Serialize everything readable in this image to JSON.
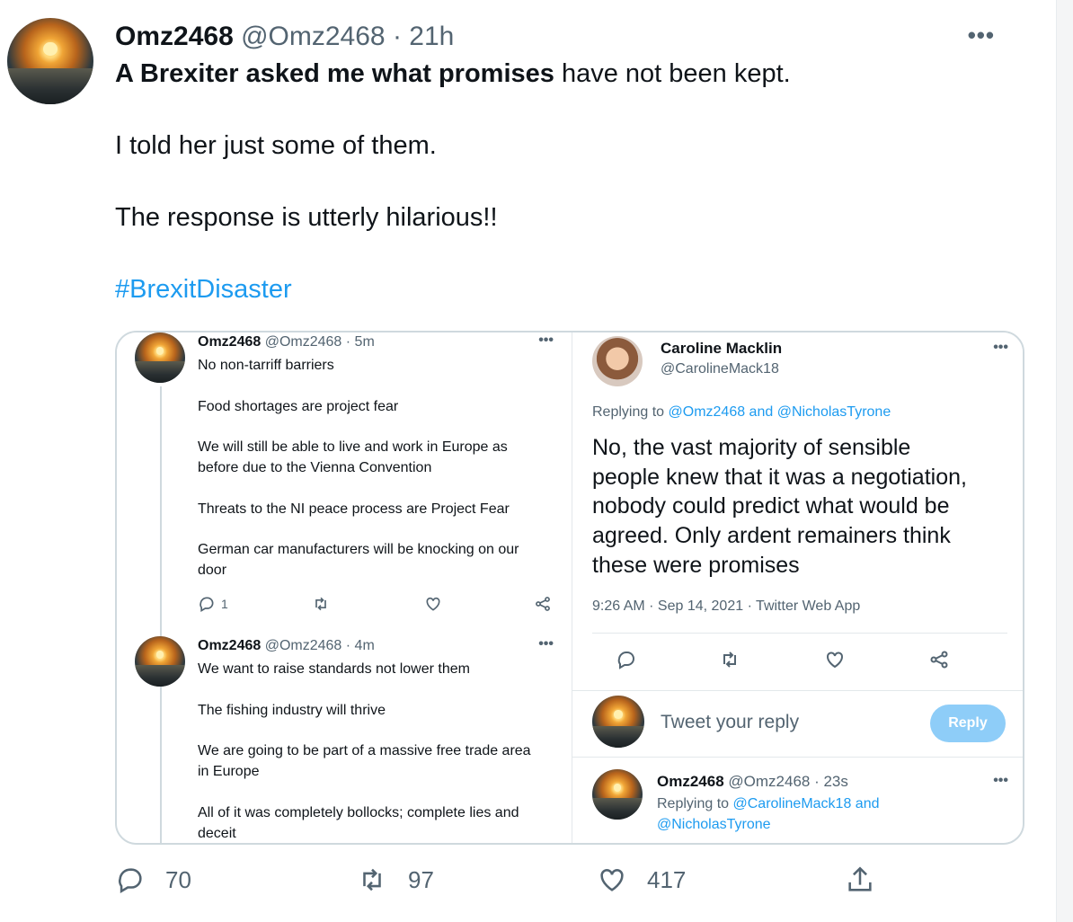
{
  "tweet": {
    "author_name": "Omz2468",
    "author_handle": "@Omz2468",
    "time": "· 21h",
    "line1_bold": "A Brexiter asked me what promises",
    "line1_rest": " have not been kept.",
    "line2": "I told her just some of them.",
    "line3": "The response is utterly hilarious!!",
    "hashtag": "#BrexitDisaster",
    "more": "•••"
  },
  "embed": {
    "left": {
      "tweet1": {
        "name": "Omz2468",
        "handle": "@Omz2468 · 5m",
        "lines": [
          "No non-tarriff barriers",
          "Food shortages are project fear",
          "We will still be able to live and work in Europe as",
          "before due to the Vienna Convention",
          "Threats to the NI peace process are Project Fear",
          "German car manufacturers will be knocking on our",
          "door"
        ],
        "reply_count": "1"
      },
      "tweet2": {
        "name": "Omz2468",
        "handle": "@Omz2468 · 4m",
        "lines": [
          "We want to raise standards not lower them",
          "The fishing industry will thrive",
          "We are going to be part of a massive free trade area",
          "in Europe",
          "All of it was completely bollocks; complete lies and",
          "deceit"
        ]
      },
      "more": "•••"
    },
    "right": {
      "name": "Caroline Macklin",
      "handle": "@CarolineMack18",
      "replying_prefix": "Replying to ",
      "replying_to": "@Omz2468 and @NicholasTyrone",
      "body_lines": [
        "No, the vast majority of sensible",
        "people knew that it was a negotiation,",
        "nobody could predict what would be",
        "agreed.  Only ardent remainers think",
        "these were promises"
      ],
      "meta": "9:26 AM · Sep 14, 2021 · Twitter Web App",
      "reply_placeholder": "Tweet your reply",
      "reply_button": "Reply",
      "bottom_tweet": {
        "name": "Omz2468",
        "handle": "@Omz2468 · 23s",
        "replying_prefix": "Replying to ",
        "replying_to_1": "@CarolineMack18 and",
        "replying_to_2": "@NicholasTyrone"
      },
      "more": "•••"
    }
  },
  "stats": {
    "replies": "70",
    "retweets": "97",
    "likes": "417"
  },
  "colors": {
    "accent": "#1d9bf0",
    "muted": "#536471",
    "reply_button_disabled": "#8ecdf8"
  }
}
